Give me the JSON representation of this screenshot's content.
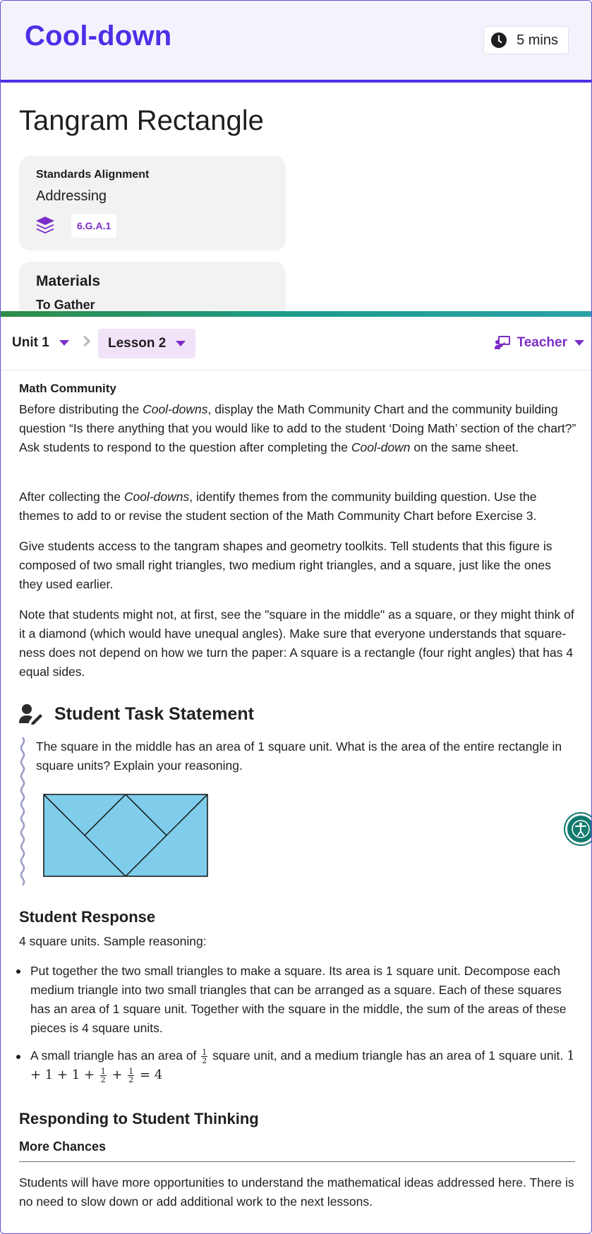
{
  "header": {
    "section_label": "Cool-down",
    "duration": "5 mins"
  },
  "lesson": {
    "title": "Tangram Rectangle"
  },
  "standards": {
    "heading": "Standards Alignment",
    "type": "Addressing",
    "code": "6.G.A.1"
  },
  "materials": {
    "heading": "Materials",
    "sub": "To Gather"
  },
  "nav": {
    "unit": "Unit 1",
    "lesson": "Lesson 2",
    "role": "Teacher"
  },
  "body": {
    "math_community_label": "Math Community",
    "p1_a": "Before distributing the ",
    "p1_cd": "Cool-downs",
    "p1_b": ", display the Math Community Chart and the community building question “Is there anything that you would like to add to the student ‘Doing Math’ section of the chart?” Ask students to respond to the question after completing the ",
    "p1_cd2": "Cool-down",
    "p1_c": " on the same sheet.",
    "p2_a": "After collecting the ",
    "p2_cd": "Cool-downs",
    "p2_b": ", identify themes from the community building question. Use the themes to add to or revise the student section of the Math Community Chart before Exercise 3.",
    "p3": "Give students access to the tangram shapes and geometry toolkits. Tell students that this figure is composed of two small right triangles, two medium right triangles, and a square, just like the ones they used earlier.",
    "p4": "Note that students might not, at first, see the \"square in the middle\" as a square, or they might think of it a diamond (which would have unequal angles). Make sure that everyone understands that square-ness does not depend on how we turn the paper: A square is a rectangle (four right angles) that has 4 equal sides."
  },
  "task": {
    "heading": "Student Task Statement",
    "text": "The square in the middle has an area of 1 square unit. What is the area of the entire rectangle in square units? Explain your reasoning."
  },
  "response": {
    "heading": "Student Response",
    "intro": "4 square units. Sample reasoning:",
    "bullet1": "Put together the two small triangles to make a square. Its area is 1 square unit. Decompose each medium triangle into two small triangles that can be arranged as a square. Each of these squares has an area of 1 square unit. Together with the square in the middle, the sum of the areas of these pieces is 4 square units.",
    "bullet2_a": "A small triangle has an area of ",
    "bullet2_b": " square unit, and a medium triangle has an area of 1 square unit. ",
    "frac_num": "1",
    "frac_den": "2",
    "eq_a": "1 + 1 + 1 + ",
    "eq_b": " + ",
    "eq_c": " = 4"
  },
  "thinking": {
    "heading": "Responding to Student Thinking",
    "sub": "More Chances",
    "text": "Students will have more opportunities to understand the mathematical ideas addressed here. There is no need to slow down or add additional work to the next lessons."
  },
  "colors": {
    "accent": "#4f2ee6",
    "purple": "#7c2dc7",
    "tangram_fill": "#7fcdea",
    "nav_stripe": "#1d9c8c",
    "accessibility": "#117a6e"
  }
}
